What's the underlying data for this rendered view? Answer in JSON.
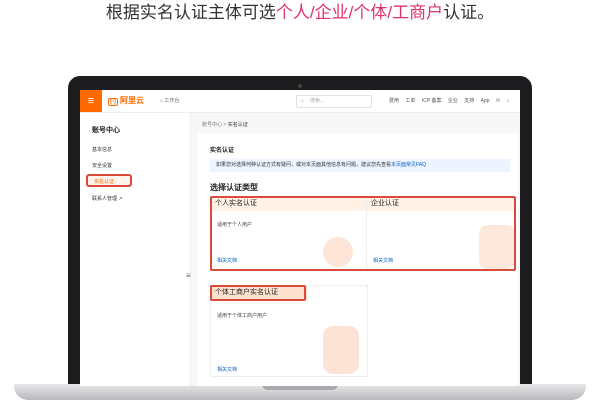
{
  "caption": {
    "prefix": "根据实名认证主体可选",
    "highlight": "个人/企业/个体/工商户",
    "suffix": "认证。"
  },
  "topbar": {
    "menu_icon": "menu-icon",
    "logo_text": "阿里云",
    "workbench_label": "工作台",
    "search_placeholder": "搜索...",
    "nav": [
      "费用",
      "工单",
      "ICP 备案",
      "企业",
      "支持",
      "App"
    ]
  },
  "sidebar": {
    "title": "账号中心",
    "items": [
      {
        "label": "基本信息"
      },
      {
        "label": "安全设置"
      },
      {
        "label": "实名认证"
      },
      {
        "label": "联系人管理"
      }
    ]
  },
  "breadcrumb": [
    "账号中心",
    ">",
    "实名认证"
  ],
  "main": {
    "section_title": "实名认证",
    "notice_text": "如果您对选择何种认证方式有疑问，或对本页面其他信息有问题，建议您先查看",
    "notice_link": "本页面常见FAQ",
    "choose_title": "选择认证类型",
    "cards": [
      {
        "title": "个人实名认证",
        "desc": "适用于个人用户",
        "link": "相关文档"
      },
      {
        "title": "企业认证",
        "desc": "",
        "link": "相关文档"
      },
      {
        "title": "个体工商户实名认证",
        "desc": "适用于个体工商户用户",
        "link": "相关文档"
      }
    ]
  },
  "colors": {
    "accent": "#ff6a00",
    "highlight": "#e0336e",
    "annotation": "#d94a3a",
    "link": "#0064c8"
  }
}
